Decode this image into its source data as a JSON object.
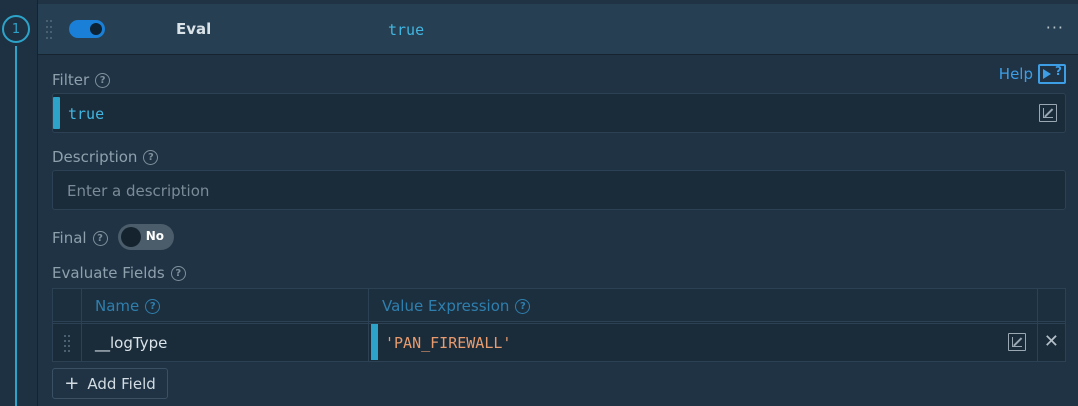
{
  "step": {
    "number": "1"
  },
  "header": {
    "function_name": "Eval",
    "filter_summary": "true",
    "more_label": "···"
  },
  "help": {
    "label": "Help"
  },
  "filter": {
    "label": "Filter",
    "value": "true"
  },
  "description": {
    "label": "Description",
    "placeholder": "Enter a description",
    "value": ""
  },
  "final": {
    "label": "Final",
    "toggle_text": "No",
    "enabled": false
  },
  "evaluate_fields": {
    "label": "Evaluate Fields",
    "columns": [
      "Name",
      "Value Expression"
    ],
    "rows": [
      {
        "name": "__logType",
        "value": "'PAN_FIREWALL'"
      }
    ]
  },
  "add_field": {
    "label": "Add Field"
  },
  "colors": {
    "accent": "#2ea3c9",
    "toggle_on": "#1a7fd6",
    "string_value": "#e79b6e",
    "help": "#3d9ee6"
  }
}
